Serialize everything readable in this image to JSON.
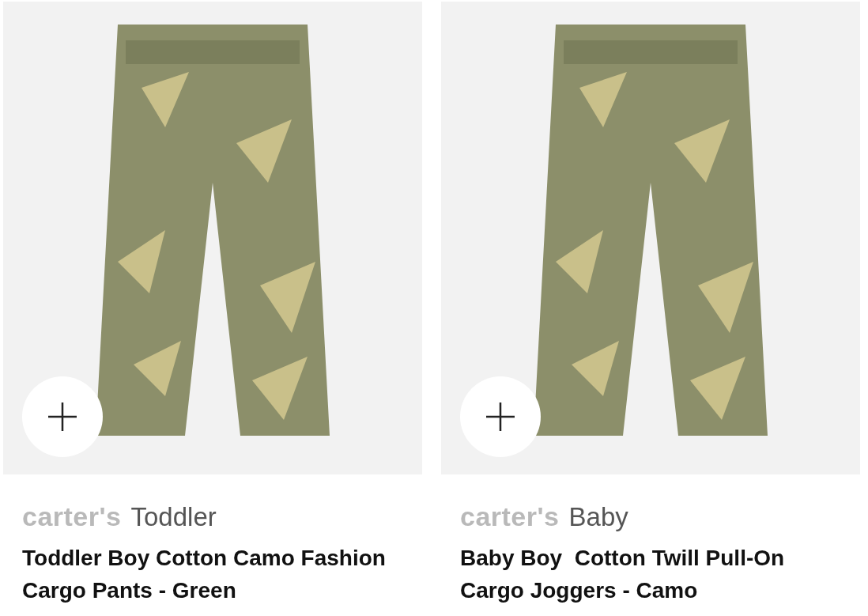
{
  "products": [
    {
      "brand": "carter's",
      "category": "Toddler",
      "name": "Toddler Boy Cotton Camo Fashion Cargo Pants - Green"
    },
    {
      "brand": "carter's",
      "category": "Baby",
      "name": "Baby Boy  Cotton Twill Pull-On Cargo Joggers - Camo"
    }
  ]
}
